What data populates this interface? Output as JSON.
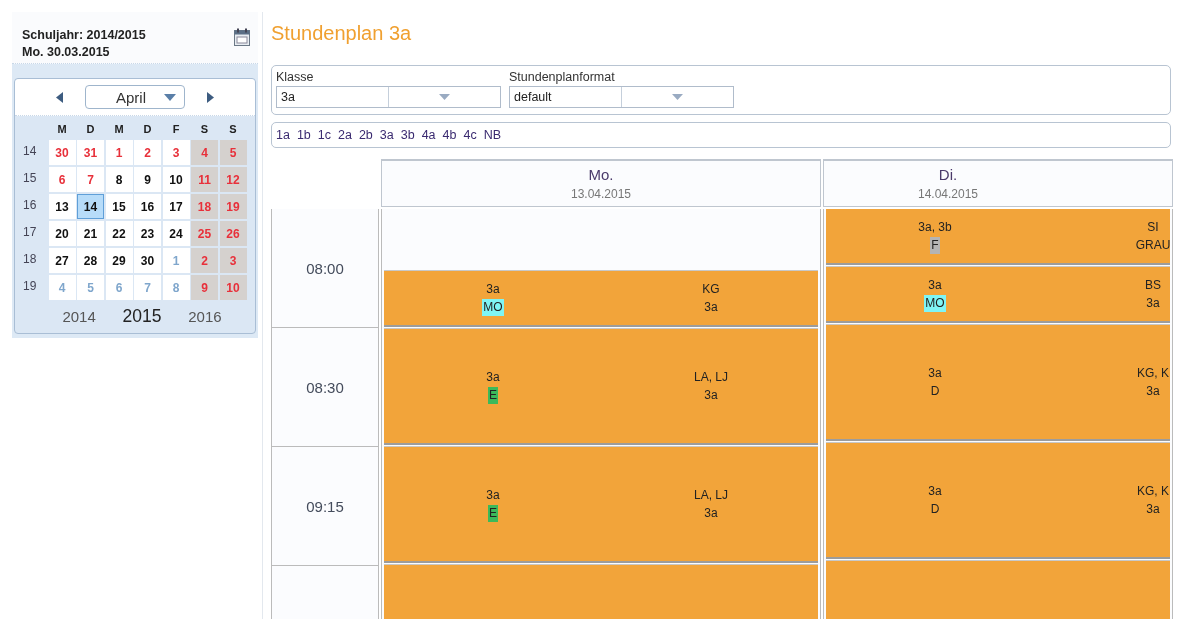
{
  "sidebar": {
    "school_year": "Schuljahr: 2014/2015",
    "date": "Mo. 30.03.2015"
  },
  "calendar": {
    "month": "April",
    "weekdays": [
      "M",
      "D",
      "M",
      "D",
      "F",
      "S",
      "S"
    ],
    "weeks": [
      {
        "number": "14",
        "days": [
          {
            "day": "30",
            "kind": "holiday",
            "selected": false
          },
          {
            "day": "31",
            "kind": "holiday",
            "selected": false
          },
          {
            "day": "1",
            "kind": "holiday",
            "selected": false
          },
          {
            "day": "2",
            "kind": "holiday",
            "selected": false
          },
          {
            "day": "3",
            "kind": "holiday",
            "selected": false
          },
          {
            "day": "4",
            "kind": "weekend",
            "selected": false
          },
          {
            "day": "5",
            "kind": "weekend",
            "selected": false
          }
        ]
      },
      {
        "number": "15",
        "days": [
          {
            "day": "6",
            "kind": "holiday",
            "selected": false
          },
          {
            "day": "7",
            "kind": "holiday",
            "selected": false
          },
          {
            "day": "8",
            "kind": "normal",
            "selected": false
          },
          {
            "day": "9",
            "kind": "normal",
            "selected": false
          },
          {
            "day": "10",
            "kind": "normal",
            "selected": false
          },
          {
            "day": "11",
            "kind": "weekend",
            "selected": false
          },
          {
            "day": "12",
            "kind": "weekend",
            "selected": false
          }
        ]
      },
      {
        "number": "16",
        "days": [
          {
            "day": "13",
            "kind": "normal",
            "selected": false
          },
          {
            "day": "14",
            "kind": "normal",
            "selected": true
          },
          {
            "day": "15",
            "kind": "normal",
            "selected": false
          },
          {
            "day": "16",
            "kind": "normal",
            "selected": false
          },
          {
            "day": "17",
            "kind": "normal",
            "selected": false
          },
          {
            "day": "18",
            "kind": "weekend",
            "selected": false
          },
          {
            "day": "19",
            "kind": "weekend",
            "selected": false
          }
        ]
      },
      {
        "number": "17",
        "days": [
          {
            "day": "20",
            "kind": "normal",
            "selected": false
          },
          {
            "day": "21",
            "kind": "normal",
            "selected": false
          },
          {
            "day": "22",
            "kind": "normal",
            "selected": false
          },
          {
            "day": "23",
            "kind": "normal",
            "selected": false
          },
          {
            "day": "24",
            "kind": "normal",
            "selected": false
          },
          {
            "day": "25",
            "kind": "weekend",
            "selected": false
          },
          {
            "day": "26",
            "kind": "weekend",
            "selected": false
          }
        ]
      },
      {
        "number": "18",
        "days": [
          {
            "day": "27",
            "kind": "normal",
            "selected": false
          },
          {
            "day": "28",
            "kind": "normal",
            "selected": false
          },
          {
            "day": "29",
            "kind": "normal",
            "selected": false
          },
          {
            "day": "30",
            "kind": "normal",
            "selected": false
          },
          {
            "day": "1",
            "kind": "other",
            "selected": false
          },
          {
            "day": "2",
            "kind": "weekend",
            "selected": false
          },
          {
            "day": "3",
            "kind": "weekend",
            "selected": false
          }
        ]
      },
      {
        "number": "19",
        "days": [
          {
            "day": "4",
            "kind": "other",
            "selected": false
          },
          {
            "day": "5",
            "kind": "other",
            "selected": false
          },
          {
            "day": "6",
            "kind": "other",
            "selected": false
          },
          {
            "day": "7",
            "kind": "other",
            "selected": false
          },
          {
            "day": "8",
            "kind": "other",
            "selected": false
          },
          {
            "day": "9",
            "kind": "weekend",
            "selected": false
          },
          {
            "day": "10",
            "kind": "weekend",
            "selected": false
          }
        ]
      }
    ],
    "years": [
      {
        "label": "2014",
        "selected": false
      },
      {
        "label": "2015",
        "selected": true
      },
      {
        "label": "2016",
        "selected": false
      }
    ]
  },
  "title": "Stundenplan 3a",
  "filters": [
    {
      "label": "Klasse",
      "value": "3a"
    },
    {
      "label": "Stundenplanformat",
      "value": "default"
    }
  ],
  "class_links": [
    "1a",
    "1b",
    "1c",
    "2a",
    "2b",
    "3a",
    "3b",
    "4a",
    "4b",
    "4c",
    "NB"
  ],
  "timetable": {
    "times": [
      "08:00",
      "08:30",
      "09:15"
    ],
    "days": [
      {
        "name": "Mo.",
        "date": "13.04.2015",
        "lessons": [
          {
            "kind": "empty"
          },
          {
            "kind": "short",
            "classes": "3a",
            "subject": "MO",
            "color": "#7ff5f5",
            "teacher": "KG",
            "room": "3a"
          },
          {
            "kind": "long",
            "classes": "3a",
            "subject": "E",
            "color": "#3cb95a",
            "teacher": "LA, LJ",
            "room": "3a"
          },
          {
            "kind": "long",
            "classes": "3a",
            "subject": "E",
            "color": "#3cb95a",
            "teacher": "LA, LJ",
            "room": "3a"
          },
          {
            "kind": "stub"
          }
        ]
      },
      {
        "name": "Di.",
        "date": "14.04.2015",
        "lessons": [
          {
            "kind": "short",
            "classes": "3a, 3b",
            "subject": "F",
            "color": "#b4b4b4",
            "teacher": "SI",
            "room": "GRAU"
          },
          {
            "kind": "short",
            "classes": "3a",
            "subject": "MO",
            "color": "#7ff5f5",
            "teacher": "BS",
            "room": "3a"
          },
          {
            "kind": "long",
            "classes": "3a",
            "subject": "D",
            "teacher": "KG, K",
            "room": "3a"
          },
          {
            "kind": "long",
            "classes": "3a",
            "subject": "D",
            "teacher": "KG, K",
            "room": "3a"
          },
          {
            "kind": "stub"
          }
        ]
      }
    ]
  }
}
